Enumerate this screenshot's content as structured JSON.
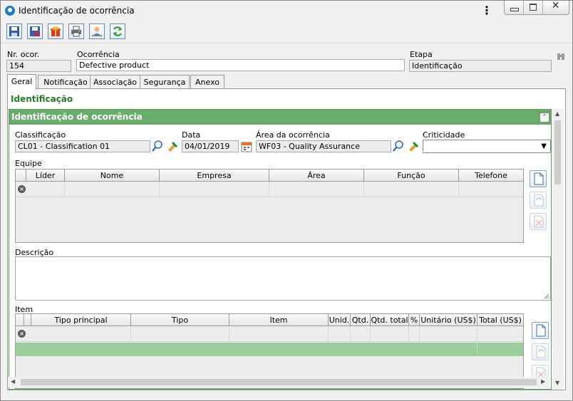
{
  "window": {
    "title": "Identificação de ocorrência"
  },
  "colors": {
    "accent_green": "#6aaa6a",
    "section_green": "#2a7a2a",
    "row_highlight": "#9dcc9d"
  },
  "header": {
    "nr_label": "Nr. ocor.",
    "nr_value": "154",
    "ocorrencia_label": "Ocorrência",
    "ocorrencia_value": "Defective product",
    "etapa_label": "Etapa",
    "etapa_value": "Identificação"
  },
  "tabs": [
    {
      "label": "Geral",
      "active": true
    },
    {
      "label": "Notificação"
    },
    {
      "label": "Associação"
    },
    {
      "label": "Segurança"
    },
    {
      "label": "Anexo"
    }
  ],
  "section": {
    "title": "Identificação"
  },
  "panel": {
    "title": "Identificação de ocorrência",
    "classificacao_label": "Classificação",
    "classificacao_value": "CL01 - Classification 01",
    "data_label": "Data",
    "data_value": "04/01/2019",
    "area_label": "Área da ocorrência",
    "area_value": "WF03 - Quality Assurance",
    "criticidade_label": "Criticidade",
    "criticidade_value": "",
    "equipe_label": "Equipe",
    "equipe_columns": [
      "Líder",
      "Nome",
      "Empresa",
      "Área",
      "Função",
      "Telefone"
    ],
    "descricao_label": "Descrição",
    "descricao_value": "",
    "item_label": "Item",
    "item_columns": [
      "Tipo principal",
      "Tipo",
      "Item",
      "Unid.",
      "Qtd.",
      "Qtd. total",
      "%",
      "Unitário (US$)",
      "Total (US$)"
    ]
  }
}
